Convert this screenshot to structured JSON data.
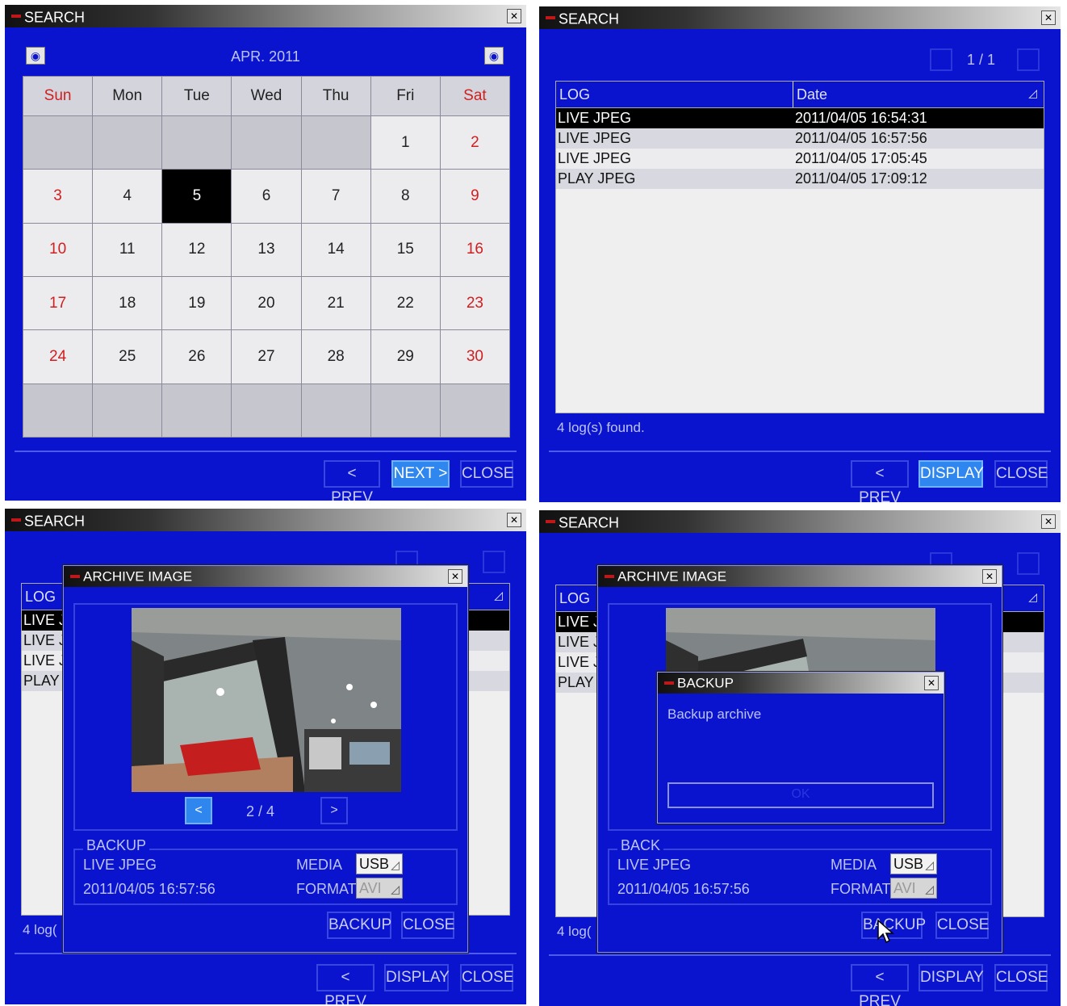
{
  "window": {
    "title": "SEARCH"
  },
  "buttons": {
    "prev": "< PREV",
    "next": "NEXT >",
    "close": "CLOSE",
    "display": "DISPLAY",
    "backup": "BACKUP",
    "ok": "OK"
  },
  "calendar": {
    "month_label": "APR. 2011",
    "weekdays": [
      "Sun",
      "Mon",
      "Tue",
      "Wed",
      "Thu",
      "Fri",
      "Sat"
    ],
    "selected_day": "5",
    "weeks": [
      [
        "",
        "",
        "",
        "",
        "",
        "1",
        "2"
      ],
      [
        "3",
        "4",
        "5",
        "6",
        "7",
        "8",
        "9"
      ],
      [
        "10",
        "11",
        "12",
        "13",
        "14",
        "15",
        "16"
      ],
      [
        "17",
        "18",
        "19",
        "20",
        "21",
        "22",
        "23"
      ],
      [
        "24",
        "25",
        "26",
        "27",
        "28",
        "29",
        "30"
      ],
      [
        "",
        "",
        "",
        "",
        "",
        "",
        ""
      ]
    ]
  },
  "log": {
    "page": "1 / 1",
    "columns": [
      "LOG",
      "Date"
    ],
    "rows": [
      {
        "log": "LIVE JPEG",
        "date": "2011/04/05 16:54:31"
      },
      {
        "log": "LIVE JPEG",
        "date": "2011/04/05 16:57:56"
      },
      {
        "log": "LIVE JPEG",
        "date": "2011/04/05 17:05:45"
      },
      {
        "log": "PLAY JPEG",
        "date": "2011/04/05 17:09:12"
      }
    ],
    "truncated_rows": [
      "LIVE J",
      "LIVE J",
      "LIVE J",
      "PLAY"
    ],
    "found": "4 log(s) found.",
    "found_truncated": "4 log(",
    "found_truncated_2": "4 log("
  },
  "archive": {
    "title": "ARCHIVE IMAGE",
    "counter": "2 / 4",
    "backup_group": "BACKUP",
    "backup_group_truncated": "BACK",
    "log_type": "LIVE JPEG",
    "timestamp": "2011/04/05 16:57:56",
    "media_label": "MEDIA",
    "media_value": "USB",
    "format_label": "FORMAT",
    "format_value": "AVI",
    "prev_label": "<",
    "next_label": ">"
  },
  "backup_dialog": {
    "title": "BACKUP",
    "message": "Backup archive",
    "progress": 0
  },
  "colors": {
    "panel_bg": "#0a14ce",
    "active_button": "#2f86ee",
    "weekend_text": "#cf1f1f",
    "selected_row": "#000000"
  },
  "icons": {
    "close": "close-icon",
    "nav_prev": "calendar-prev-icon",
    "nav_next": "calendar-next-icon",
    "cursor": "mouse-pointer-icon",
    "dropdown": "dropdown-arrow-icon"
  }
}
